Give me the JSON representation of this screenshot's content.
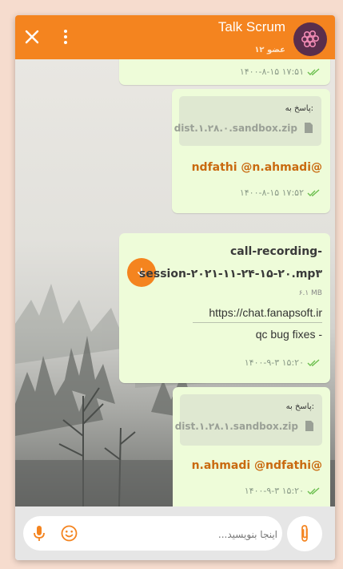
{
  "header": {
    "title": "Talk Scrum",
    "subtitle": "۱۲ عضو"
  },
  "messages": [
    {
      "time": "۱۴۰۰-۸-۱۵ ۱۷:۵۱"
    },
    {
      "reply_label": "پاسخ به:",
      "reply_file": "dist.۱.۲۸.۰.sandbox.zip",
      "text": "ndfathi @n.ahmadi@",
      "time": "۱۴۰۰-۸-۱۵ ۱۷:۵۲"
    },
    {
      "file_name_line1": "call-recording-",
      "file_name_line2": "session-۲۰۲۱-۱۱-۲۴-۱۵-۲۰.mp۳",
      "file_size": "۶.۱ MB",
      "link": "https://chat.fanapsoft.ir",
      "caption": "qc bug fixes -",
      "time": "۱۴۰۰-۹-۳ ۱۵:۲۰"
    },
    {
      "reply_label": "پاسخ به:",
      "reply_file": "dist.۱.۲۸.۱.sandbox.zip",
      "text": "n.ahmadi @ndfathi@",
      "time": "۱۴۰۰-۹-۳ ۱۵:۲۰"
    }
  ],
  "composer": {
    "placeholder": "اینجا بنویسید..."
  },
  "colors": {
    "accent": "#f4841f",
    "bubble": "#eefcd9",
    "mention": "#c96a10"
  }
}
